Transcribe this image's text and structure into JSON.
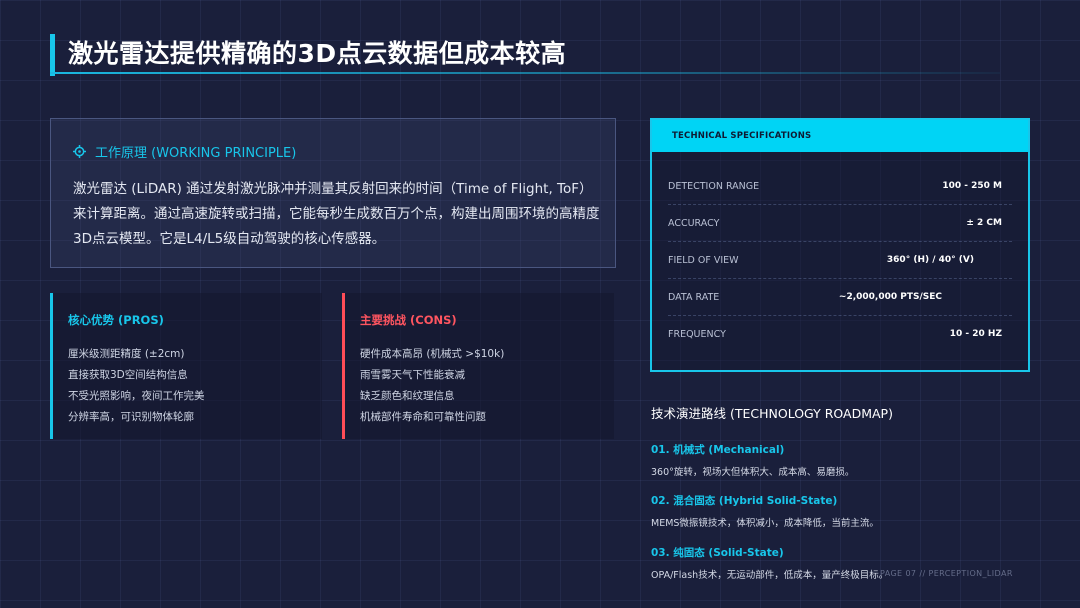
{
  "title": "激光雷达提供精确的3D点云数据但成本较高",
  "principle": {
    "icon": "target-icon",
    "heading": "工作原理 (WORKING PRINCIPLE)",
    "body": "激光雷达 (LiDAR) 通过发射激光脉冲并测量其反射回来的时间（Time of Flight, ToF）来计算距离。通过高速旋转或扫描，它能每秒生成数百万个点，构建出周围环境的高精度3D点云模型。它是L4/L5级自动驾驶的核心传感器。"
  },
  "pros": {
    "title": "核心优势 (PROS)",
    "items": [
      "厘米级测距精度 (±2cm)",
      "直接获取3D空间结构信息",
      "不受光照影响，夜间工作完美",
      "分辨率高，可识别物体轮廓"
    ]
  },
  "cons": {
    "title": "主要挑战 (CONS)",
    "items": [
      "硬件成本高昂 (机械式 >$10k)",
      "雨雪雾天气下性能衰减",
      "缺乏颜色和纹理信息",
      "机械部件寿命和可靠性问题"
    ]
  },
  "specs": {
    "header": "TECHNICAL SPECIFICATIONS",
    "rows": [
      {
        "label": "DETECTION RANGE",
        "value": "100 - 250 M"
      },
      {
        "label": "ACCURACY",
        "value": "± 2 CM"
      },
      {
        "label": "FIELD OF VIEW",
        "value": "360° (H) / 40° (V)"
      },
      {
        "label": "DATA RATE",
        "value": "~2,000,000 PTS/SEC"
      },
      {
        "label": "FREQUENCY",
        "value": "10 - 20 HZ"
      }
    ]
  },
  "roadmap": {
    "title": "技术演进路线 (TECHNOLOGY ROADMAP)",
    "items": [
      {
        "heading": "01. 机械式 (Mechanical)",
        "desc": "360°旋转，视场大但体积大、成本高、易磨损。"
      },
      {
        "heading": "02. 混合固态 (Hybrid Solid-State)",
        "desc": "MEMS微振镜技术，体积减小，成本降低，当前主流。"
      },
      {
        "heading": "03. 纯固态 (Solid-State)",
        "desc": "OPA/Flash技术，无运动部件，低成本，量产终极目标。"
      }
    ]
  },
  "footer": "PAGE 07 // PERCEPTION_LIDAR",
  "colors": {
    "background": "#1a1f3b",
    "accent": "#18c6ea",
    "cons_accent": "#ff4d57",
    "spec_header": "#00d4f5"
  }
}
